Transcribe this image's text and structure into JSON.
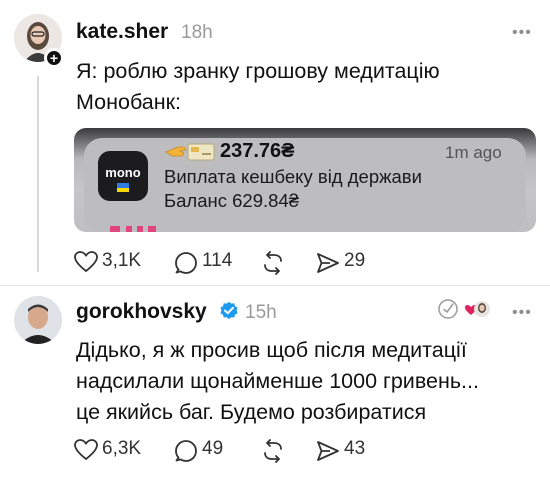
{
  "post1": {
    "username": "kate.sher",
    "time": "18h",
    "more_label": "•••",
    "text_line1": "Я: роблю зранку грошову медитацію",
    "text_line2": "Монобанк:",
    "notification": {
      "app_logo_text": "mono",
      "amount": "237.76₴",
      "time": "1m ago",
      "line1": "Виплата кешбеку від держави",
      "line2": "Баланс 629.84₴"
    },
    "likes": "3,1K",
    "comments": "114",
    "reposts": "",
    "shares": "29"
  },
  "post2": {
    "username": "gorokhovsky",
    "time": "15h",
    "more_label": "•••",
    "text_line1": "Дідько, я ж просив щоб після медитації",
    "text_line2": "надсилали щонайменше 1000 гривень...",
    "text_line3": "це якийсь баг. Будемо розбиратися",
    "likes": "6,3K",
    "comments": "49",
    "reposts": "",
    "shares": "43"
  },
  "icons": {
    "like": "heart-outline-icon",
    "comment": "speech-bubble-icon",
    "repost": "repost-arrows-icon",
    "share": "paper-plane-icon",
    "verified": "verified-badge-icon",
    "plus": "plus-icon"
  },
  "colors": {
    "verified": "#1d9bf0",
    "heart_reaction": "#e0245e",
    "muted_text": "#9a9a9a"
  }
}
